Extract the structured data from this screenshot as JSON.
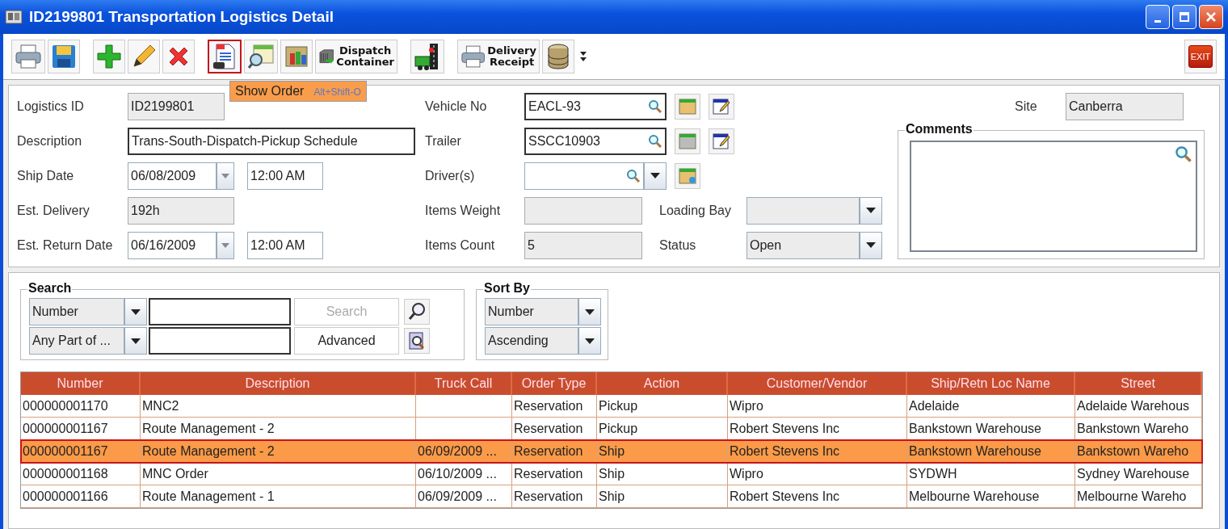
{
  "window": {
    "title": "ID2199801 Transportation Logistics Detail"
  },
  "toolbar": {
    "groups": [
      [
        {
          "kind": "print",
          "selected": false
        },
        {
          "kind": "save",
          "selected": false
        }
      ],
      [
        {
          "kind": "add",
          "selected": false
        },
        {
          "kind": "edit",
          "selected": false
        },
        {
          "kind": "delete",
          "selected": false
        }
      ],
      [
        {
          "kind": "document",
          "selected": true
        },
        {
          "kind": "report",
          "selected": false
        },
        {
          "kind": "grid",
          "selected": false
        },
        {
          "kind": "container",
          "selected": false,
          "lines": [
            "Dispatch",
            "Container"
          ]
        }
      ],
      [
        {
          "kind": "route",
          "selected": false
        }
      ],
      [
        {
          "kind": "receipt",
          "selected": false,
          "lines": [
            "Delivery",
            "Receipt"
          ]
        },
        {
          "kind": "database",
          "selected": false
        },
        {
          "kind": "more",
          "selected": false
        }
      ]
    ],
    "exit": "EXIT",
    "tooltip": {
      "label": "Show Order",
      "shortcut": "Alt+Shift-O"
    }
  },
  "form": {
    "logistics_id": {
      "label": "Logistics ID",
      "value": "ID2199801"
    },
    "description": {
      "label": "Description",
      "value": "Trans-South-Dispatch-Pickup Schedule"
    },
    "ship_date": {
      "label": "Ship Date",
      "date": "06/08/2009",
      "time": "12:00 AM"
    },
    "est_delivery": {
      "label": "Est. Delivery",
      "value": "192h"
    },
    "est_return_date": {
      "label": "Est. Return Date",
      "date": "06/16/2009",
      "time": "12:00 AM"
    },
    "vehicle_no": {
      "label": "Vehicle No",
      "value": "EACL-93"
    },
    "trailer": {
      "label": "Trailer",
      "value": "SSCC10903"
    },
    "drivers": {
      "label": "Driver(s)"
    },
    "items_weight": {
      "label": "Items Weight"
    },
    "items_count": {
      "label": "Items Count",
      "value": "5"
    },
    "loading_bay": {
      "label": "Loading Bay"
    },
    "status": {
      "label": "Status",
      "value": "Open"
    },
    "site": {
      "label": "Site",
      "value": "Canberra"
    },
    "comments": {
      "label": "Comments"
    }
  },
  "search": {
    "title": "Search",
    "field": "Number",
    "match": "Any Part of ...",
    "search_button": {
      "label": "Search",
      "disabled": true
    },
    "advanced_button": {
      "label": "Advanced",
      "disabled": false
    }
  },
  "sort": {
    "title": "Sort By",
    "field": "Number",
    "order": "Ascending"
  },
  "table": {
    "columns": [
      "Number",
      "Description",
      "Truck Call",
      "Order Type",
      "Action",
      "Customer/Vendor",
      "Ship/Retn Loc Name",
      "Street"
    ],
    "rows": [
      {
        "selected": false,
        "cells": [
          "000000001170",
          "MNC2",
          "",
          "Reservation",
          "Pickup",
          "Wipro",
          "Adelaide",
          "Adelaide Warehous"
        ]
      },
      {
        "selected": false,
        "cells": [
          "000000001167",
          "Route Management - 2",
          "",
          "Reservation",
          "Pickup",
          "Robert Stevens Inc",
          "Bankstown Warehouse",
          "Bankstown Wareho"
        ]
      },
      {
        "selected": true,
        "cells": [
          "000000001167",
          "Route Management - 2",
          "06/09/2009 ...",
          "Reservation",
          "Ship",
          "Robert Stevens Inc",
          "Bankstown Warehouse",
          "Bankstown Wareho"
        ]
      },
      {
        "selected": false,
        "cells": [
          "000000001168",
          "MNC Order",
          "06/10/2009 ...",
          "Reservation",
          "Ship",
          "Wipro",
          "SYDWH",
          "Sydney Warehouse"
        ]
      },
      {
        "selected": false,
        "cells": [
          "000000001166",
          "Route Management - 1",
          "06/09/2009 ...",
          "Reservation",
          "Ship",
          "Robert Stevens Inc",
          "Melbourne Warehouse",
          "Melbourne Wareho"
        ]
      }
    ]
  }
}
